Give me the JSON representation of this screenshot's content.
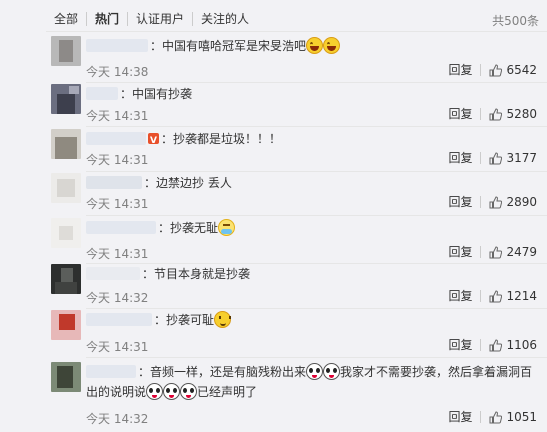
{
  "tabs": {
    "items": [
      "全部",
      "热门",
      "认证用户",
      "关注的人"
    ],
    "count": "共500条"
  },
  "comments": [
    {
      "text": "中国有嘻哈冠军是宋旻浩吧",
      "time": "今天 14:38",
      "reply": "回复",
      "likes": "6542"
    },
    {
      "text": "中国有抄袭",
      "time": "今天 14:31",
      "reply": "回复",
      "likes": "5280"
    },
    {
      "text": "抄袭都是垃圾！！！",
      "time": "今天 14:31",
      "reply": "回复",
      "likes": "3177"
    },
    {
      "text": "边禁边抄 丢人",
      "time": "今天 14:31",
      "reply": "回复",
      "likes": "2890"
    },
    {
      "text": "抄袭无耻",
      "time": "今天 14:31",
      "reply": "回复",
      "likes": "2479"
    },
    {
      "text": "节目本身就是抄袭",
      "time": "今天 14:32",
      "reply": "回复",
      "likes": "1214"
    },
    {
      "text": "抄袭可耻",
      "time": "今天 14:31",
      "reply": "回复",
      "likes": "1106"
    },
    {
      "text_a": "音频一样，还是有脑残粉出来",
      "text_b": "我家才不需要抄袭，然后拿着漏洞百",
      "text_c": "出的说明说",
      "text_d": "已经声明了",
      "time": "今天 14:32",
      "reply": "回复",
      "likes": "1051"
    }
  ],
  "icons": {
    "like": "thumbs-up-icon",
    "laugh": "laughing-tears-emoji",
    "shame": "ashamed-emoji",
    "smirk": "smirk-emoji",
    "panda": "panda-emoji"
  },
  "colors": {
    "background": "#f2f2f5",
    "text": "#333333",
    "muted": "#808080",
    "divider": "#e6e6e6"
  }
}
